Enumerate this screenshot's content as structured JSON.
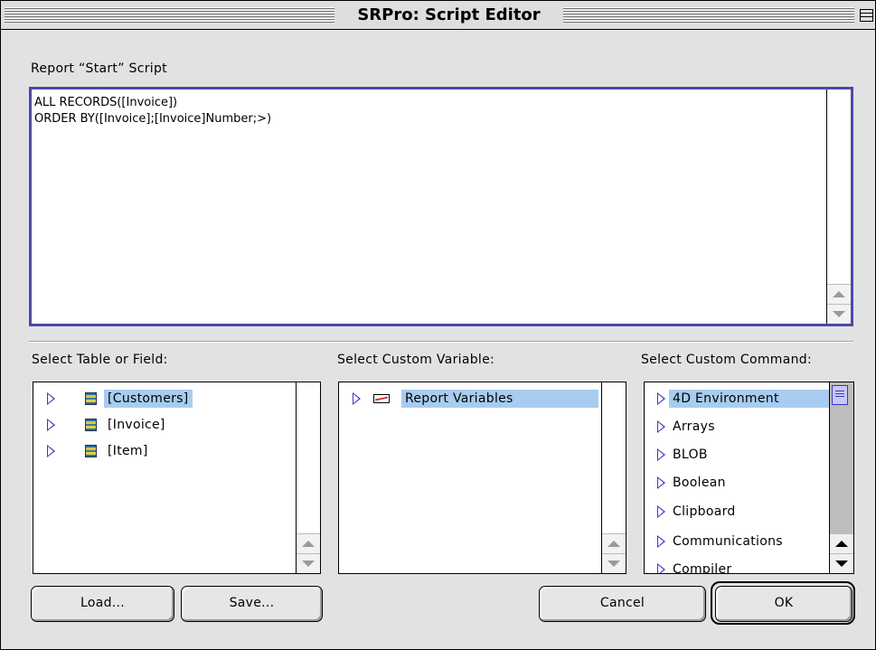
{
  "window": {
    "title": "SRPro: Script Editor"
  },
  "script": {
    "label": "Report “Start” Script",
    "lines": [
      "ALL RECORDS([Invoice])",
      "ORDER BY([Invoice];[Invoice]Number;>)"
    ],
    "text": "ALL RECORDS([Invoice])\nORDER BY([Invoice];[Invoice]Number;>)"
  },
  "tables": {
    "label": "Select Table or Field:",
    "items": [
      "[Customers]",
      "[Invoice]",
      "[Item]"
    ],
    "selected_index": 0
  },
  "variables": {
    "label": "Select Custom Variable:",
    "items": [
      "Report Variables"
    ],
    "selected_index": 0
  },
  "commands": {
    "label": "Select Custom Command:",
    "items": [
      "4D Environment",
      "Arrays",
      "BLOB",
      "Boolean",
      "Clipboard",
      "Communications",
      "Compiler"
    ],
    "selected_index": 0
  },
  "buttons": {
    "load": "Load...",
    "save": "Save...",
    "cancel": "Cancel",
    "ok": "OK"
  },
  "colors": {
    "selection": "#a8ccf0",
    "focus_ring": "#4a4aa8",
    "disclosure": "#3a3ac0"
  }
}
